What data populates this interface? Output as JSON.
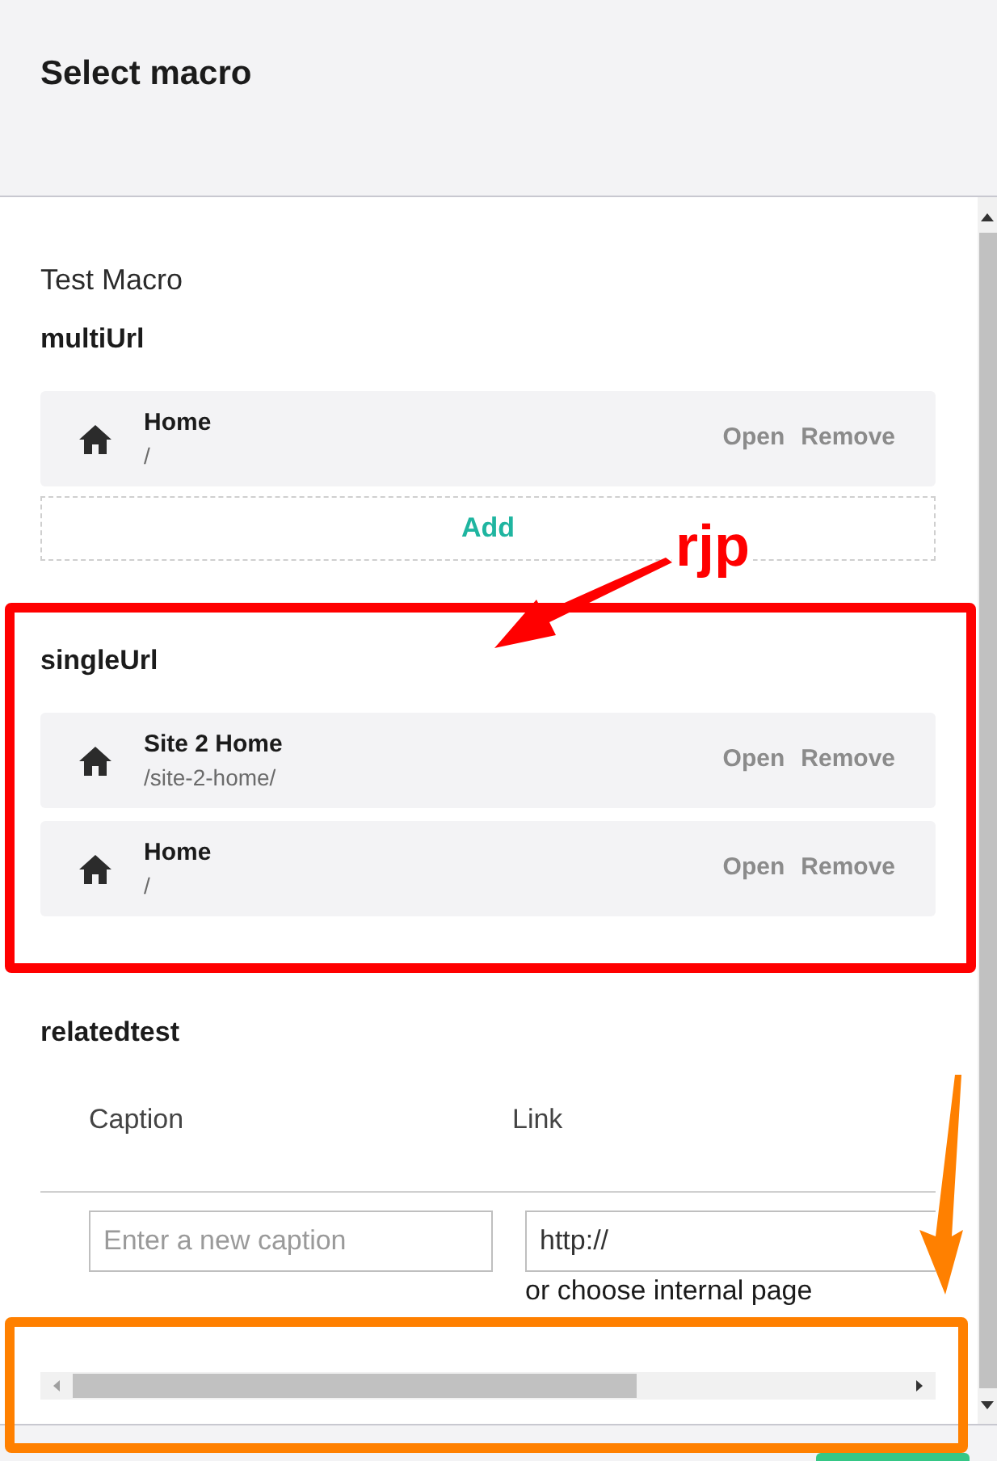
{
  "dialog": {
    "title": "Select macro"
  },
  "macro_name": "Test Macro",
  "url_fields": [
    {
      "label": "multiUrl",
      "items": [
        {
          "name": "Home",
          "url": "/",
          "actions": [
            "Open",
            "Remove"
          ]
        }
      ],
      "add_button": "Add"
    },
    {
      "label": "singleUrl",
      "items": [
        {
          "name": "Site 2 Home",
          "url": "/site-2-home/",
          "actions": [
            "Open",
            "Remove"
          ]
        },
        {
          "name": "Home",
          "url": "/",
          "actions": [
            "Open",
            "Remove"
          ]
        }
      ]
    }
  ],
  "related": {
    "label": "relatedtest",
    "columns": [
      "Caption",
      "Link"
    ],
    "caption_input": {
      "placeholder": "Enter a new caption"
    },
    "link_input": {
      "value": "http://"
    },
    "internal_link": "or choose internal page"
  },
  "annotations": [
    {
      "kind": "box",
      "color": "#ff0000"
    },
    {
      "kind": "arrow",
      "color": "#ff0000"
    },
    {
      "kind": "label",
      "color": "#ff0000",
      "text": "rjp"
    },
    {
      "kind": "box",
      "color": "#ff8000"
    },
    {
      "kind": "arrow",
      "color": "#ff8000"
    }
  ]
}
